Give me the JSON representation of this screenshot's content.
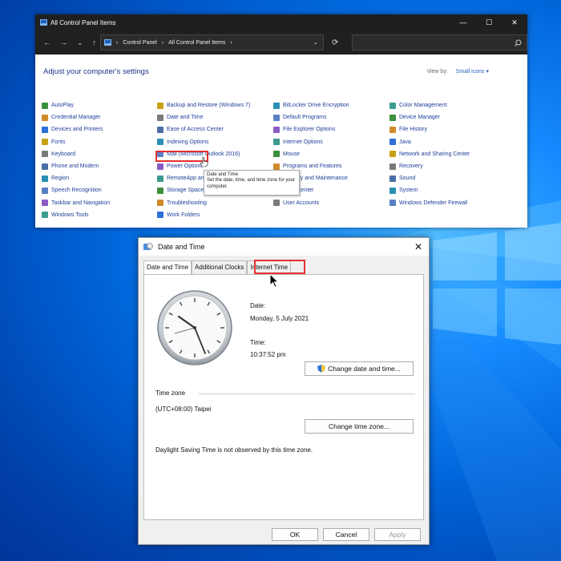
{
  "control_panel": {
    "window_title": "All Control Panel Items",
    "breadcrumb": [
      "Control Panel",
      "All Control Panel Items"
    ],
    "heading": "Adjust your computer's settings",
    "view_by_label": "View by:",
    "view_by_value": "Small icons",
    "columns": [
      [
        "AutoPlay",
        "Credential Manager",
        "Devices and Printers",
        "Fonts",
        "Keyboard",
        "Phone and Modem",
        "Region",
        "Speech Recognition",
        "Taskbar and Navigation",
        "Windows Tools"
      ],
      [
        "Backup and Restore (Windows 7)",
        "Date and Time",
        "Ease of Access Center",
        "Indexing Options",
        "Mail (Microsoft Outlook 2016)",
        "Power Options",
        "RemoteApp and Desktop Connections",
        "Storage Spaces",
        "Troubleshooting",
        "Work Folders"
      ],
      [
        "BitLocker Drive Encryption",
        "Default Programs",
        "File Explorer Options",
        "Internet Options",
        "Mouse",
        "Programs and Features",
        "Security and Maintenance",
        "Sync Center",
        "User Accounts"
      ],
      [
        "Color Management",
        "Device Manager",
        "File History",
        "Java",
        "Network and Sharing Center",
        "Recovery",
        "Sound",
        "System",
        "Windows Defender Firewall"
      ]
    ],
    "tooltip": {
      "title": "Date and Time",
      "text": "Set the date, time, and time zone for your computer."
    }
  },
  "dialog": {
    "title": "Date and Time",
    "tabs": [
      "Date and Time",
      "Additional Clocks",
      "Internet Time"
    ],
    "date_label": "Date:",
    "date_value": "Monday, 5 July 2021",
    "time_label": "Time:",
    "time_value": "10:37:52 pm",
    "change_datetime_button": "Change date and time...",
    "time_zone_header": "Time zone",
    "time_zone_value": "(UTC+08:00) Taipei",
    "change_tz_button": "Change time zone...",
    "dst_note": "Daylight Saving Time is not observed by this time zone.",
    "ok": "OK",
    "cancel": "Cancel",
    "apply": "Apply"
  },
  "colors": {
    "highlight": "#e53030",
    "link": "#1e3f9a",
    "desktop": "#0063d8"
  }
}
